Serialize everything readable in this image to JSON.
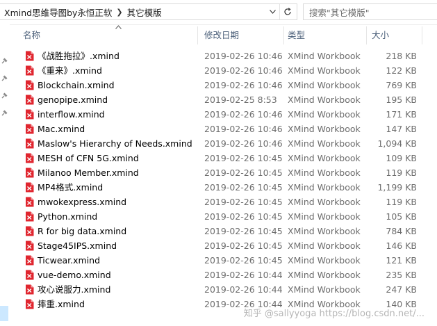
{
  "addressbar": {
    "crumbs": [
      "Xmind思维导图by永恒正软",
      "其它模版"
    ],
    "search_placeholder": "搜索\"其它模版\""
  },
  "icons": {
    "chevron": "chevron-right-icon",
    "dropdown": "chevron-down-icon",
    "refresh": "refresh-icon",
    "search": "search-icon",
    "file": "xmind-file-icon",
    "pin": "pin-icon"
  },
  "colors": {
    "file_icon": "#e0262f",
    "header_text": "#4c607a",
    "meta_text": "#6d6d6d",
    "selection": "#cce8ff"
  },
  "columns": {
    "name": "名称",
    "date": "修改日期",
    "type": "类型",
    "size": "大小"
  },
  "files": [
    {
      "name": "《战胜拖拉》.xmind",
      "date": "2019-02-26 10:46",
      "type": "XMind Workbook",
      "size": "218 KB"
    },
    {
      "name": "《重来》.xmind",
      "date": "2019-02-26 10:46",
      "type": "XMind Workbook",
      "size": "122 KB"
    },
    {
      "name": "Blockchain.xmind",
      "date": "2019-02-26 10:46",
      "type": "XMind Workbook",
      "size": "769 KB"
    },
    {
      "name": "genopipe.xmind",
      "date": "2019-02-25 8:53",
      "type": "XMind Workbook",
      "size": "195 KB"
    },
    {
      "name": "interflow.xmind",
      "date": "2019-02-26 10:46",
      "type": "XMind Workbook",
      "size": "171 KB"
    },
    {
      "name": "Mac.xmind",
      "date": "2019-02-26 10:46",
      "type": "XMind Workbook",
      "size": "147 KB"
    },
    {
      "name": "Maslow's Hierarchy of Needs.xmind",
      "date": "2019-02-26 10:46",
      "type": "XMind Workbook",
      "size": "1,094 KB"
    },
    {
      "name": "MESH of CFN 5G.xmind",
      "date": "2019-02-26 10:45",
      "type": "XMind Workbook",
      "size": "109 KB"
    },
    {
      "name": "Milanoo Member.xmind",
      "date": "2019-02-26 10:45",
      "type": "XMind Workbook",
      "size": "119 KB"
    },
    {
      "name": "MP4格式.xmind",
      "date": "2019-02-26 10:45",
      "type": "XMind Workbook",
      "size": "1,199 KB"
    },
    {
      "name": "mwokexpress.xmind",
      "date": "2019-02-26 10:45",
      "type": "XMind Workbook",
      "size": "119 KB"
    },
    {
      "name": "Python.xmind",
      "date": "2019-02-26 10:45",
      "type": "XMind Workbook",
      "size": "105 KB"
    },
    {
      "name": "R for big data.xmind",
      "date": "2019-02-26 10:45",
      "type": "XMind Workbook",
      "size": "784 KB"
    },
    {
      "name": "Stage45IPS.xmind",
      "date": "2019-02-26 10:45",
      "type": "XMind Workbook",
      "size": "146 KB"
    },
    {
      "name": "Ticwear.xmind",
      "date": "2019-02-26 10:45",
      "type": "XMind Workbook",
      "size": "121 KB"
    },
    {
      "name": "vue-demo.xmind",
      "date": "2019-02-26 10:44",
      "type": "XMind Workbook",
      "size": "235 KB"
    },
    {
      "name": "攻心说服力.xmind",
      "date": "2019-02-26 10:44",
      "type": "XMind Workbook",
      "size": "247 KB"
    },
    {
      "name": "摔重.xmind",
      "date": "2019-02-26 10:44",
      "type": "XMind Workbook",
      "size": "140 KB"
    }
  ],
  "watermark": "知乎 @sallyyoga  https://blog.csdn.net/..."
}
